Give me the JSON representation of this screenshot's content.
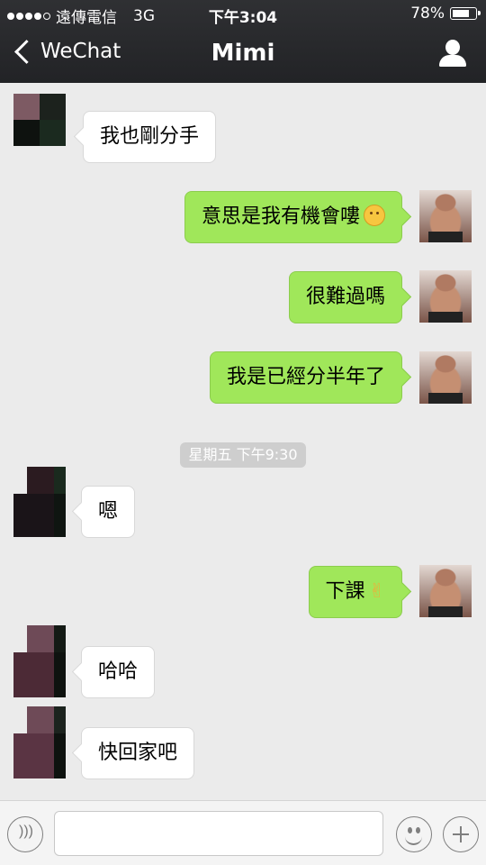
{
  "status_bar": {
    "carrier": "遠傳電信",
    "network": "3G",
    "time": "下午3:04",
    "battery": "78%",
    "battery_level": 0.78
  },
  "nav": {
    "back_label": "WeChat",
    "title": "Mimi",
    "back_icon": "chevron-left-icon",
    "profile_icon": "person-icon"
  },
  "messages": [
    {
      "sender": "them",
      "text": "我也剛分手"
    },
    {
      "sender": "me",
      "text": "意思是我有機會嘍",
      "emoji": "thinking-face-icon"
    },
    {
      "sender": "me",
      "text": "很難過嗎"
    },
    {
      "sender": "me",
      "text": "我是已經分半年了"
    },
    {
      "sender": "them",
      "text": "嗯"
    },
    {
      "sender": "me",
      "text": "下課",
      "emoji": "victory-hand-icon"
    },
    {
      "sender": "them",
      "text": "哈哈"
    },
    {
      "sender": "them",
      "text": "快回家吧"
    }
  ],
  "timestamp": "星期五 下午9:30",
  "input_bar": {
    "value": "",
    "voice_icon": "voice-icon",
    "emoji_icon": "smiley-icon",
    "more_icon": "plus-icon"
  },
  "colors": {
    "nav_bg": "#2a2b2e",
    "outgoing_bubble": "#a0e75a",
    "incoming_bubble": "#ffffff",
    "chat_bg": "#ebebeb"
  }
}
